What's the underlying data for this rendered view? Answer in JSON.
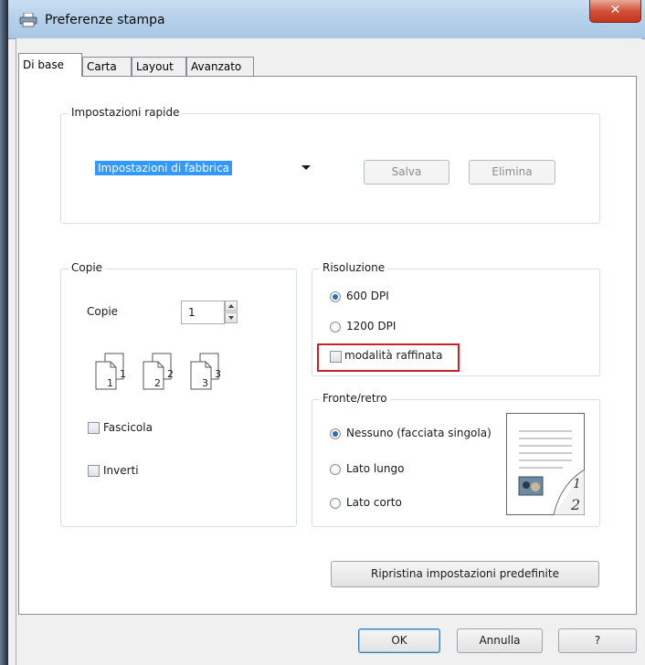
{
  "window": {
    "title": "Preferenze stampa",
    "close_glyph": "✕"
  },
  "tabs": [
    {
      "label": "Di base",
      "active": true
    },
    {
      "label": "Carta",
      "active": false
    },
    {
      "label": "Layout",
      "active": false
    },
    {
      "label": "Avanzato",
      "active": false
    }
  ],
  "quick_settings": {
    "legend": "Impostazioni rapide",
    "selected": "Impostazioni di fabbrica",
    "save_label": "Salva",
    "delete_label": "Elimina"
  },
  "copies": {
    "legend": "Copie",
    "label": "Copie",
    "value": "1",
    "collate_pages": [
      "1",
      "2",
      "3"
    ],
    "collate_label": "Fascicola",
    "reverse_label": "Inverti"
  },
  "resolution": {
    "legend": "Risoluzione",
    "options": [
      {
        "label": "600 DPI",
        "selected": true
      },
      {
        "label": "1200 DPI",
        "selected": false
      }
    ],
    "fine_mode_label": "modalità raffinata"
  },
  "duplex": {
    "legend": "Fronte/retro",
    "options": [
      {
        "label": "Nessuno (facciata singola)",
        "selected": true
      },
      {
        "label": "Lato lungo",
        "selected": false
      },
      {
        "label": "Lato corto",
        "selected": false
      }
    ],
    "preview_pages": [
      "1",
      "2"
    ]
  },
  "restore_label": "Ripristina impostazioni predefinite",
  "footer": {
    "ok_label": "OK",
    "cancel_label": "Annulla",
    "help_label": "?"
  },
  "colors": {
    "selection": "#3399ff",
    "highlight_border": "#c8232c",
    "radio_dot": "#2c6db6"
  }
}
